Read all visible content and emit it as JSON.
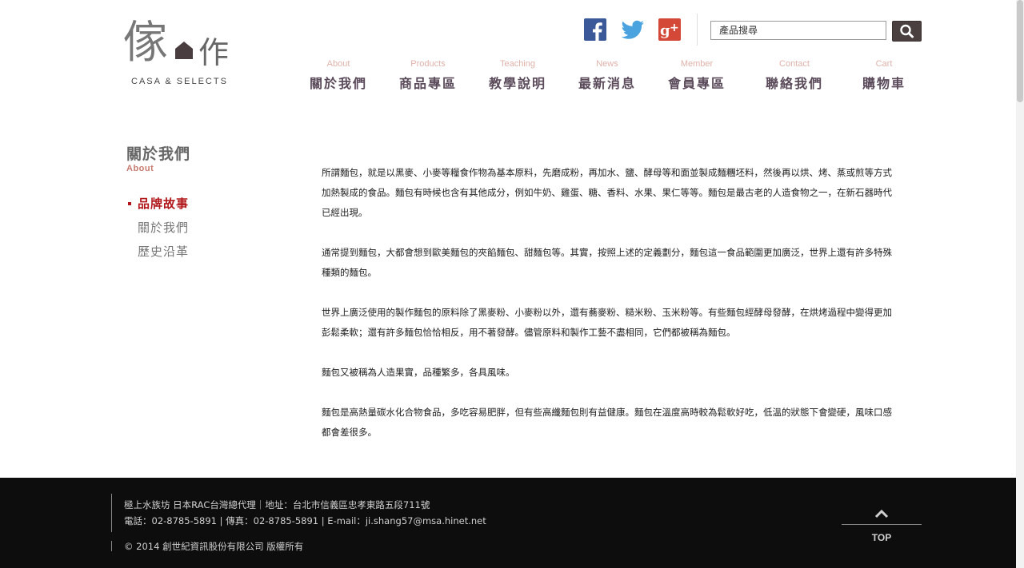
{
  "logo": {
    "char_left": "傢",
    "char_right": "作",
    "subtitle": "CASA & SELECTS"
  },
  "social": [
    {
      "name": "facebook",
      "icon": "facebook-icon",
      "color": "#3b5998"
    },
    {
      "name": "twitter",
      "icon": "twitter-icon",
      "color": "#4aa3df"
    },
    {
      "name": "google-plus",
      "icon": "google-plus-icon",
      "color": "#d34836"
    }
  ],
  "search": {
    "placeholder": "產品搜尋",
    "button_icon": "search-icon"
  },
  "nav": [
    {
      "en": "About",
      "zh": "關於我們"
    },
    {
      "en": "Products",
      "zh": "商品專區"
    },
    {
      "en": "Teaching",
      "zh": "教學說明"
    },
    {
      "en": "News",
      "zh": "最新消息"
    },
    {
      "en": "Member",
      "zh": "會員專區"
    },
    {
      "en": "Contact",
      "zh": "聯絡我們"
    },
    {
      "en": "Cart",
      "zh": "購物車"
    }
  ],
  "sidebar": {
    "title": "關於我們",
    "subtitle": "About",
    "items": [
      {
        "label": "品牌故事",
        "active": true
      },
      {
        "label": "關於我們",
        "active": false
      },
      {
        "label": "歷史沿革",
        "active": false
      }
    ]
  },
  "content": {
    "paragraphs": [
      "所謂麵包，就是以黑麥、小麥等糧食作物為基本原料，先磨成粉，再加水、鹽、酵母等和面並製成麵糰坯料，然後再以烘、烤、蒸或煎等方式加熱製成的食品。麵包有時候也含有其他成分，例如牛奶、雞蛋、糖、香料、水果、果仁等等。麵包是最古老的人造食物之一，在新石器時代已經出現。",
      "通常提到麵包，大都會想到歐美麵包的夾餡麵包、甜麵包等。其實，按照上述的定義劃分，麵包這一食品範圍更加廣泛，世界上還有許多特殊種類的麵包。",
      "世界上廣泛使用的製作麵包的原料除了黑麥粉、小麥粉以外，還有蕎麥粉、糙米粉、玉米粉等。有些麵包經酵母發酵，在烘烤過程中變得更加彭鬆柔軟；還有許多麵包恰恰相反，用不著發酵。儘管原料和製作工藝不盡相同，它們都被稱為麵包。",
      "麵包又被稱為人造果實，品種繁多，各具風味。",
      "麵包是高熱量碳水化合物食品，多吃容易肥胖，但有些高纖麵包則有益健康。麵包在溫度高時較為鬆軟好吃，低溫的狀態下會變硬，風味口感都會差很多。"
    ]
  },
  "footer": {
    "line1": "極上水族坊 日本RAC台灣總代理｜地址：台北市信義區忠孝東路五段711號",
    "line2": "電話：02-8785-5891 | 傳真：02-8785-5891 | E-mail：ji.shang57@msa.hinet.net",
    "copyright": "© 2014 創世紀資訊股份有限公司 版權所有",
    "top_label": "TOP",
    "top_icon": "chevron-up-icon"
  },
  "colors": {
    "accent_red": "#b0161a",
    "nav_en": "#e0b2aa",
    "nav_zh": "#5a4a5a",
    "footer_bg": "#0d0d0d",
    "search_button": "#4a4040"
  }
}
